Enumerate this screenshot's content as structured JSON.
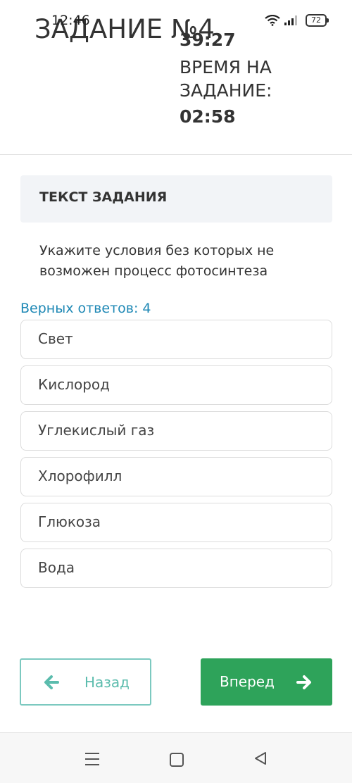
{
  "status_bar": {
    "time": "12:46",
    "battery": "72"
  },
  "header": {
    "task_title": "ЗАДАНИЕ №4",
    "time_left": "39:27",
    "time_label": "ВРЕМЯ НА ЗАДАНИЕ:",
    "time_for_task": "02:58"
  },
  "section": {
    "title": "ТЕКСТ ЗАДАНИЯ"
  },
  "question": {
    "text": "Укажите условия без которых не возможен процесс фотосинтеза"
  },
  "correct_answers_label": "Верных ответов: 4",
  "answers": [
    "Свет",
    "Кислород",
    "Углекислый газ",
    "Хлорофилл",
    "Глюкоза",
    "Вода"
  ],
  "buttons": {
    "back_label": "Назад",
    "next_label": "Вперед"
  },
  "icons": {
    "wifi": "wifi-icon",
    "signal": "signal-icon",
    "battery": "battery-icon",
    "back_arrow": "arrow-left-icon",
    "next_arrow": "arrow-right-icon",
    "nav_menu": "menu-icon",
    "nav_home": "home-square-icon",
    "nav_back": "triangle-back-icon"
  },
  "colors": {
    "accent_blue": "#1e88b5",
    "next_button": "#2ea35a",
    "back_button_border": "#7cc9c0",
    "back_button_text": "#5bbcad"
  }
}
